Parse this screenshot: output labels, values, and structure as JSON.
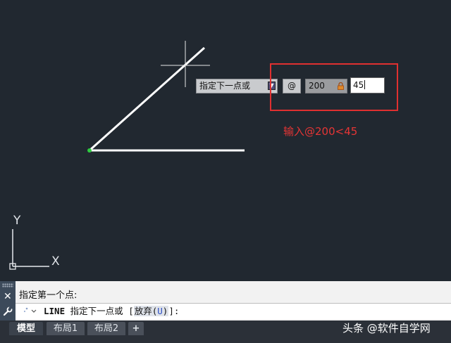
{
  "dynamic_input": {
    "prompt_text": "指定下一点或",
    "at_symbol": "@",
    "length_value": "200",
    "angle_value": "45"
  },
  "annotation": {
    "text": "输入@200<45",
    "color": "#e53535"
  },
  "ucs": {
    "x_label": "X",
    "y_label": "Y"
  },
  "command_line": {
    "history": "指定第一个点:",
    "command": "LINE",
    "prompt": "指定下一点或",
    "option_open": "[",
    "option_label": "放弃(",
    "option_key": "U",
    "option_close_paren": ")",
    "option_close": "]:"
  },
  "tabs": [
    {
      "label": "模型",
      "active": true
    },
    {
      "label": "布局1",
      "active": false
    },
    {
      "label": "布局2",
      "active": false
    },
    {
      "label": "+",
      "active": false
    }
  ],
  "watermark": "头条 @软件自学网",
  "colors": {
    "canvas_bg": "#212830",
    "highlight": "#e03030"
  }
}
